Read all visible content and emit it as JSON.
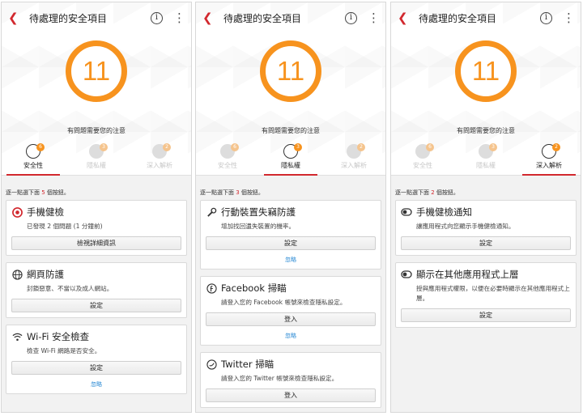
{
  "colors": {
    "accent": "#d2282e",
    "orange": "#f7931e",
    "link": "#2a8ad4"
  },
  "screens": [
    {
      "title": "待處理的安全項目",
      "count": "11",
      "attention": "有問題需要您的注意",
      "tabs": [
        {
          "label": "安全性",
          "badge": "6",
          "icon": "shield-icon"
        },
        {
          "label": "隱私權",
          "badge": "3",
          "icon": "privacy-lock-icon"
        },
        {
          "label": "深入解析",
          "badge": "2",
          "icon": "speedometer-icon"
        }
      ],
      "hint_pre": "逐一點選下面 ",
      "hint_num": "5",
      "hint_post": " 個按鈕。",
      "cards": [
        {
          "title": "手機健檢",
          "desc": "已發現 2 個問題 (1 分鐘前)",
          "button": "檢視詳細資訊",
          "ignore": "",
          "icon": "target-icon"
        },
        {
          "title": "網頁防護",
          "desc": "封鎖惡意、不當以及成人網站。",
          "button": "設定",
          "ignore": "",
          "icon": "globe-icon"
        },
        {
          "title": "Wi-Fi 安全檢查",
          "desc": "檢查 Wi-Fi 網路是否安全。",
          "button": "設定",
          "ignore": "忽略",
          "icon": "wifi-icon"
        }
      ]
    },
    {
      "title": "待處理的安全項目",
      "count": "11",
      "attention": "有問題需要您的注意",
      "tabs": [
        {
          "label": "安全性",
          "badge": "6",
          "icon": "shield-icon"
        },
        {
          "label": "隱私權",
          "badge": "3",
          "icon": "privacy-lock-icon"
        },
        {
          "label": "深入解析",
          "badge": "2",
          "icon": "speedometer-icon"
        }
      ],
      "hint_pre": "逐一點選下面 ",
      "hint_num": "3",
      "hint_post": " 個按鈕。",
      "cards": [
        {
          "title": "行動裝置失竊防護",
          "desc": "增加找回遺失裝置的機率。",
          "button": "設定",
          "ignore": "忽略",
          "icon": "wrench-icon"
        },
        {
          "title": "Facebook 掃瞄",
          "desc": "請登入您的 Facebook 帳號來檢查隱私設定。",
          "button": "登入",
          "ignore": "忽略",
          "icon": "facebook-icon"
        },
        {
          "title": "Twitter 掃瞄",
          "desc": "請登入您的 Twitter 帳號來檢查隱私設定。",
          "button": "登入",
          "ignore": "",
          "icon": "twitter-icon"
        }
      ]
    },
    {
      "title": "待處理的安全項目",
      "count": "11",
      "attention": "有問題需要您的注意",
      "tabs": [
        {
          "label": "安全性",
          "badge": "6",
          "icon": "shield-icon"
        },
        {
          "label": "隱私權",
          "badge": "3",
          "icon": "privacy-lock-icon"
        },
        {
          "label": "深入解析",
          "badge": "2",
          "icon": "speedometer-icon"
        }
      ],
      "hint_pre": "逐一點選下面 ",
      "hint_num": "2",
      "hint_post": " 個按鈕。",
      "cards": [
        {
          "title": "手機健檢通知",
          "desc": "讓應用程式向您顯示手機健檢通知。",
          "button": "設定",
          "ignore": "",
          "icon": "toggle-icon"
        },
        {
          "title": "顯示在其他應用程式上層",
          "desc": "授與應用程式權限，以便在必要時顯示在其他應用程式上層。",
          "button": "設定",
          "ignore": "",
          "icon": "toggle-icon"
        }
      ]
    }
  ]
}
